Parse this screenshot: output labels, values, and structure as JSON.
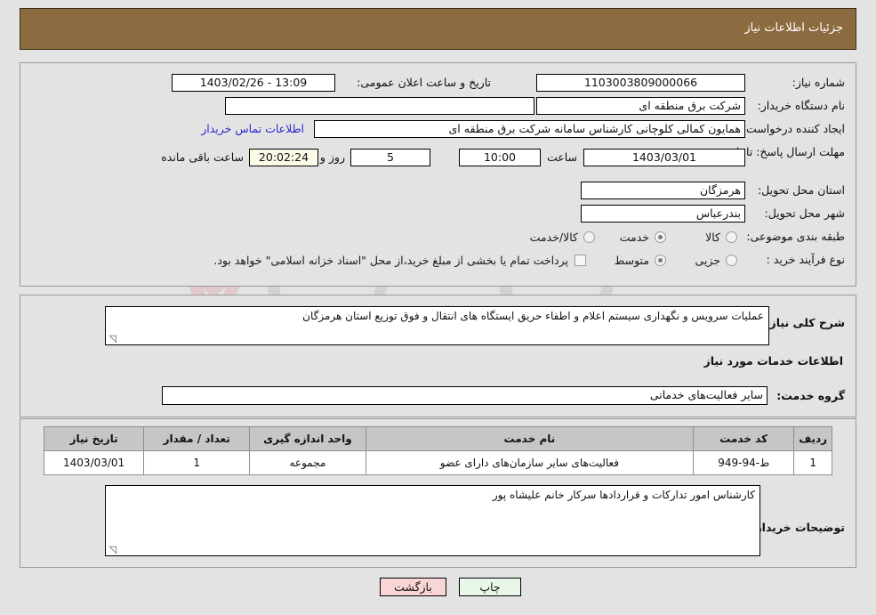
{
  "header": {
    "title": "جزئیات اطلاعات نیاز"
  },
  "main_form": {
    "need_number_label": "شماره نیاز:",
    "need_number_value": "1103003809000066",
    "announce_datetime_label": "تاریخ و ساعت اعلان عمومی:",
    "announce_datetime_value": "13:09 - 1403/02/26",
    "buyer_org_label": "نام دستگاه خریدار:",
    "buyer_org_value": "شرکت برق منطقه ای",
    "buyer_org_second_value": "",
    "requester_label": "ایجاد کننده درخواست:",
    "requester_value": "همایون کمالی کلوچانی کارشناس سامانه شرکت برق منطقه ای",
    "buyer_contact_link": "اطلاعات تماس خریدار",
    "deadline_label": "مهلت ارسال پاسخ: تا تاریخ:",
    "deadline_date_value": "1403/03/01",
    "hour_label": "ساعت",
    "deadline_time_value": "10:00",
    "days_value": "5",
    "days_label": "روز و",
    "remaining_time_value": "20:02:24",
    "remaining_label": "ساعت باقی مانده",
    "province_label": "استان محل تحویل:",
    "province_value": "هرمزگان",
    "city_label": "شهر محل تحویل:",
    "city_value": "بندرعباس",
    "category_label": "طبقه بندی موضوعی:",
    "category_options": [
      {
        "label": "کالا",
        "selected": false
      },
      {
        "label": "خدمت",
        "selected": true
      },
      {
        "label": "کالا/خدمت",
        "selected": false
      }
    ],
    "process_label": "نوع فرآیند خرید :",
    "process_options": [
      {
        "label": "جزیی",
        "selected": false
      },
      {
        "label": "متوسط",
        "selected": true
      }
    ],
    "treasury_checkbox_label": "پرداخت تمام یا بخشی از مبلغ خرید،از محل \"اسناد خزانه اسلامی\" خواهد بود.",
    "treasury_checked": false
  },
  "description": {
    "general_label": "شرح کلی نیاز:",
    "general_value": "عملیات سرویس و نگهداری سیستم اعلام و اطفاء حریق  ایستگاه های انتقال و فوق توزیع استان هرمزگان",
    "services_heading": "اطلاعات خدمات مورد نیاز",
    "group_label": "گروه خدمت:",
    "group_value": "سایر فعالیت‌های خدماتی"
  },
  "table": {
    "columns": [
      "ردیف",
      "کد خدمت",
      "نام خدمت",
      "واحد اندازه گیری",
      "تعداد / مقدار",
      "تاریخ نیاز"
    ],
    "rows": [
      {
        "index": "1",
        "code": "ط-94-949",
        "name": "فعالیت‌های سایر سازمان‌های دارای عضو",
        "unit": "مجموعه",
        "quantity": "1",
        "need_date": "1403/03/01"
      }
    ]
  },
  "buyer_notes": {
    "label": "توضیحات خریدار:",
    "value": "کارشناس امور تدارکات و قراردادها سرکار خانم علیشاه پور"
  },
  "footer": {
    "print_label": "چاپ",
    "back_label": "بازگشت"
  },
  "watermark": {
    "text": "AriaTender.net"
  },
  "colors": {
    "header_bar": "#8d6b41",
    "page_bg": "#e3e3e3",
    "link": "#2a2ad0",
    "print_button": "#e9f7e9",
    "back_button": "#f9d5d5",
    "table_header": "#c6c6c6"
  }
}
